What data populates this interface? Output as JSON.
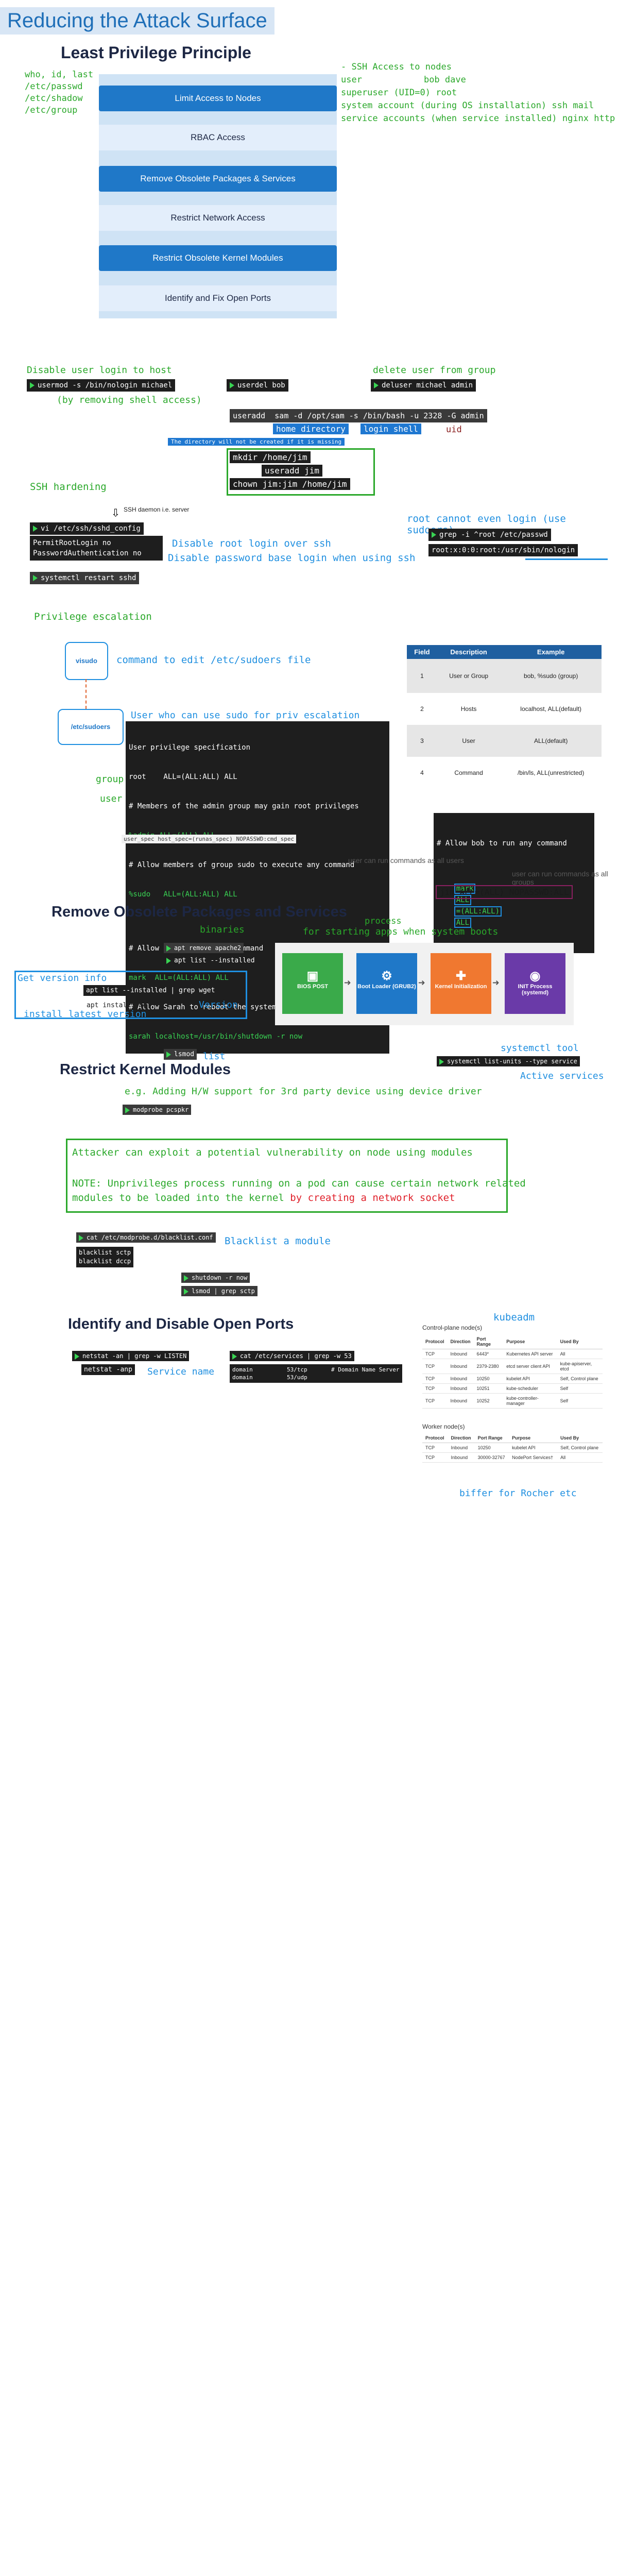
{
  "title": "Reducing the Attack Surface",
  "lp": {
    "heading": "Least Privilege Principle",
    "files": [
      "who, id, last",
      "/etc/passwd",
      "/etc/shadow",
      "/etc/group"
    ],
    "stack": [
      "Limit Access to Nodes",
      "RBAC Access",
      "Remove Obsolete Packages & Services",
      "Restrict Network Access",
      "Restrict Obsolete Kernel Modules",
      "Identify and Fix Open Ports"
    ],
    "ssh_notes": [
      "- SSH Access to nodes",
      "user",
      "bob dave",
      "superuser (UID=0) root",
      "system account (during OS installation) ssh mail",
      "service accounts (when service installed) nginx http"
    ]
  },
  "users": {
    "disable_login": "Disable user login to host",
    "cmd_usermod": "usermod -s /bin/nologin michael",
    "remove_shell": "(by removing shell access)",
    "cmd_userdel": "userdel bob",
    "delete_group": "delete user from group",
    "cmd_deluser": "deluser michael admin",
    "cmd_useradd": "useradd  sam -d /opt/sam -s /bin/bash -u 2328 -G admin",
    "home_dir": "home directory",
    "login_shell": "login shell",
    "uid": "uid",
    "dir_note": "The directory will not be created if it is missing",
    "cmd_mkdir": "mkdir /home/jim",
    "cmd_useradd_jim": "useradd jim",
    "cmd_chown": "chown jim:jim /home/jim"
  },
  "ssh": {
    "heading": "SSH hardening",
    "daemon": "SSH daemon i.e. server",
    "cmd_vi": "vi /etc/ssh/sshd_config",
    "cfg1": "PermitRootLogin no",
    "cfg2": "PasswordAuthentication no",
    "note1": "Disable root login over ssh",
    "note2": "Disable password base login when using ssh",
    "cmd_restart": "systemctl restart sshd",
    "root_note": "root cannot even login (use sudoers)",
    "cmd_grep": "grep -i ^root /etc/passwd",
    "grep_out": "root:x:0:0:root:/usr/sbin/nologin"
  },
  "priv": {
    "heading": "Privilege escalation",
    "visudo": "visudo",
    "visudo_note": "command to edit /etc/sudoers file",
    "sudoers": "/etc/sudoers",
    "sudo_note": "User who can use sudo for priv escalation",
    "sudoers_lines": [
      "User privilege specification",
      "root    ALL=(ALL:ALL) ALL",
      "# Members of the admin group may gain root privileges",
      "%admin ALL=(ALL) ALL",
      "# Allow members of group sudo to execute any command",
      "%sudo   ALL=(ALL:ALL) ALL",
      "",
      "# Allow mark to run any command",
      "mark  ALL=(ALL:ALL) ALL",
      "# Allow Sarah to reboot the system",
      "sarah localhost=/usr/bin/shutdown -r now"
    ],
    "group_label": "group",
    "user_label": "user",
    "host_label": "host",
    "runas_label": "runas",
    "spec_line": "user_spec  host_spec=(runas_spec)  NOPASSWD:cmd_spec",
    "table_headers": [
      "Field",
      "Description",
      "Example"
    ],
    "table_rows": [
      [
        "1",
        "User or Group",
        "bob, %sudo (group)"
      ],
      [
        "2",
        "Hosts",
        "localhost, ALL(default)"
      ],
      [
        "3",
        "User",
        "ALL(default)"
      ],
      [
        "4",
        "Command",
        "/bin/ls, ALL(unrestricted)"
      ]
    ],
    "allow_comment": "# Allow bob to run any command",
    "allow_parts": [
      "mark",
      "ALL",
      "=(ALL:ALL)",
      "ALL"
    ],
    "all_users_note": "user can run commands as all users",
    "all_groups_note": "user can run commands as all groups",
    "jim_line": "jim ALL=(ALL) NOPASSWD:ALL"
  },
  "pkgs": {
    "heading": "Remove Obsolete Packages and Services",
    "binaries": "binaries",
    "process": "process",
    "boot_note": "for starting apps when system boots",
    "cmd_apt_remove": "apt remove apache2",
    "cmd_apt_list": "apt list --installed",
    "version_info": "Get version info",
    "cmd_grep_wget": "apt list --installed | grep wget",
    "cmd_install": "apt install wget -y",
    "version": "Version",
    "install_latest": "install latest version",
    "boot_steps": [
      "BIOS POST",
      "Boot Loader (GRUB2)",
      "Kernel Initialization",
      "INIT Process (systemd)"
    ],
    "systemctl_tool": "systemctl tool",
    "cmd_list_units": "systemctl list-units --type service",
    "active_services": "Active services"
  },
  "kernel": {
    "heading": "Restrict Kernel Modules",
    "cmd_lsmod": "lsmod",
    "list": "list",
    "hw_note": "e.g. Adding H/W support for 3rd party device using device driver",
    "cmd_modprobe": "modprobe pcspkr",
    "attack1": "Attacker can exploit a potential vulnerability on node using modules",
    "attack2a": "NOTE: Unprivileges process running on a pod can cause certain network related",
    "attack2b": "modules to be loaded into the kernel ",
    "attack2c": "by creating a network socket",
    "cmd_cat_blacklist": "cat /etc/modprobe.d/blacklist.conf",
    "blacklist1": "blacklist sctp",
    "blacklist2": "blacklist dccp",
    "blacklist_note": "Blacklist a module",
    "cmd_shutdown": "shutdown -r now",
    "cmd_lsmod_grep": "lsmod | grep sctp"
  },
  "ports": {
    "heading": "Identify and Disable Open Ports",
    "cmd_netstat": "netstat -an | grep -w LISTEN",
    "netstat_anp": "netstat -anp",
    "cmd_services": "cat /etc/services | grep -w 53",
    "services_lines": [
      "domain          53/tcp       # Domain Name Server",
      "domain          53/udp"
    ],
    "service_name": "Service name",
    "kubeadm": "kubeadm",
    "cp_title": "Control-plane node(s)",
    "cp_headers": [
      "Protocol",
      "Direction",
      "Port Range",
      "Purpose",
      "Used By"
    ],
    "cp_rows": [
      [
        "TCP",
        "Inbound",
        "6443*",
        "Kubernetes API server",
        "All"
      ],
      [
        "TCP",
        "Inbound",
        "2379-2380",
        "etcd server client API",
        "kube-apiserver, etcd"
      ],
      [
        "TCP",
        "Inbound",
        "10250",
        "kubelet API",
        "Self, Control plane"
      ],
      [
        "TCP",
        "Inbound",
        "10251",
        "kube-scheduler",
        "Self"
      ],
      [
        "TCP",
        "Inbound",
        "10252",
        "kube-controller-manager",
        "Self"
      ]
    ],
    "w_title": "Worker node(s)",
    "w_headers": [
      "Protocol",
      "Direction",
      "Port Range",
      "Purpose",
      "Used By"
    ],
    "w_rows": [
      [
        "TCP",
        "Inbound",
        "10250",
        "kubelet API",
        "Self, Control plane"
      ],
      [
        "TCP",
        "Inbound",
        "30000-32767",
        "NodePort Services†",
        "All"
      ]
    ],
    "rancher": "biffer for Rocher etc"
  }
}
